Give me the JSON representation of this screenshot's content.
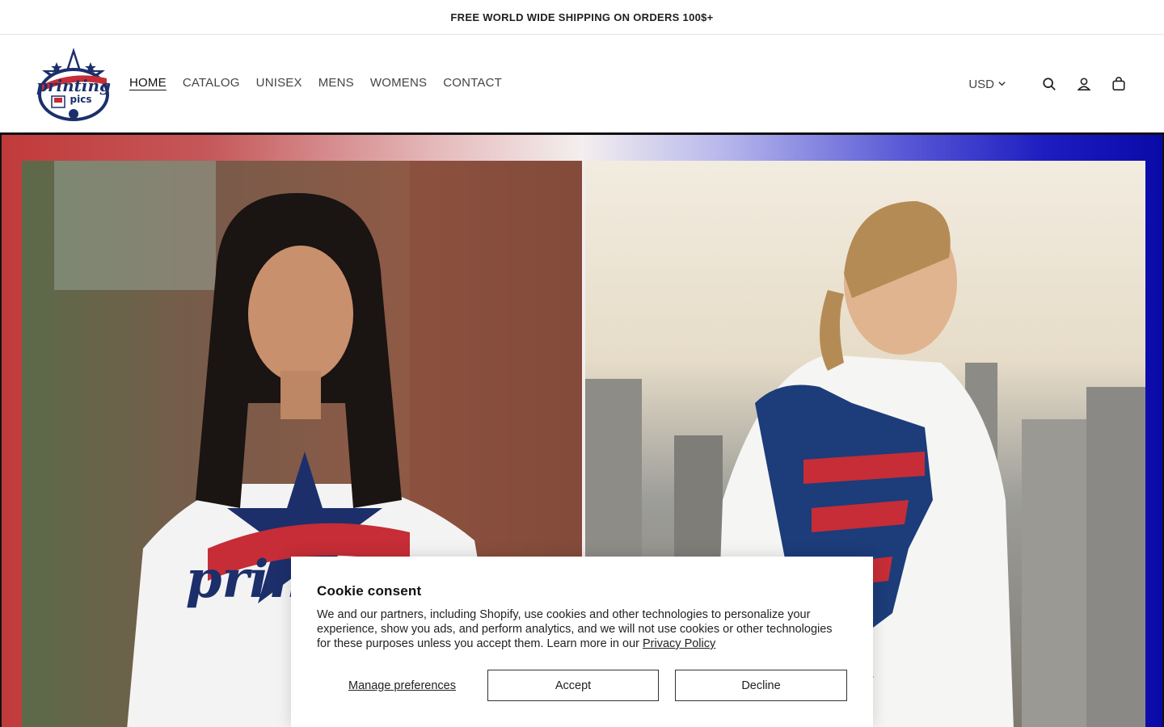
{
  "announcement": {
    "text": "FREE WORLD WIDE SHIPPING ON ORDERS 100$+"
  },
  "logo": {
    "text_main": "printing",
    "text_sub": "pics"
  },
  "nav": {
    "items": [
      {
        "label": "HOME",
        "active": true
      },
      {
        "label": "CATALOG",
        "active": false
      },
      {
        "label": "UNISEX",
        "active": false
      },
      {
        "label": "MENS",
        "active": false
      },
      {
        "label": "WOMENS",
        "active": false
      },
      {
        "label": "CONTACT",
        "active": false
      }
    ]
  },
  "header_right": {
    "currency": "USD",
    "icons": [
      "search-icon",
      "account-icon",
      "cart-icon"
    ]
  },
  "hero": {
    "colors": {
      "red": "#c13a3a",
      "blue": "#0a0aa8"
    },
    "left_image": "woman-in-patriotic-star-tshirt",
    "right_image": "woman-in-flag-fist-tshirt"
  },
  "cookie": {
    "title": "Cookie consent",
    "body": "We and our partners, including Shopify, use cookies and other technologies to personalize your experience, show you ads, and perform analytics, and we will not use cookies or other technologies for these purposes unless you accept them. Learn more in our ",
    "policy_link": "Privacy Policy",
    "manage_label": "Manage preferences",
    "accept_label": "Accept",
    "decline_label": "Decline"
  }
}
